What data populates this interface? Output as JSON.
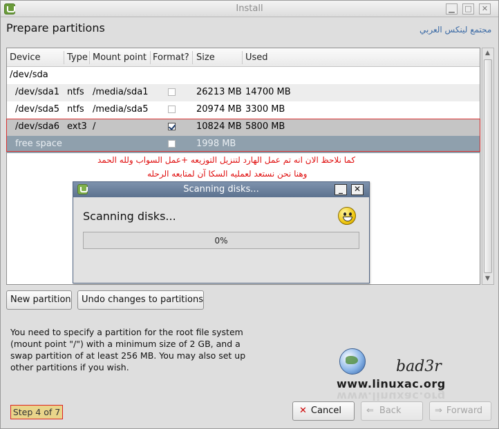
{
  "window": {
    "title": "Install"
  },
  "page": {
    "title": "Prepare partitions",
    "community_logo": "مجتمع لينكس العربي"
  },
  "table": {
    "columns": [
      "Device",
      "Type",
      "Mount point",
      "Format?",
      "Size",
      "Used"
    ],
    "disk": "/dev/sda",
    "rows": [
      {
        "device": "/dev/sda1",
        "type": "ntfs",
        "mount": "/media/sda1",
        "format": false,
        "size": "26213 MB",
        "used": "14700 MB"
      },
      {
        "device": "/dev/sda5",
        "type": "ntfs",
        "mount": "/media/sda5",
        "format": false,
        "size": "20974 MB",
        "used": "3300 MB"
      },
      {
        "device": "/dev/sda6",
        "type": "ext3",
        "mount": "/",
        "format": true,
        "size": "10824 MB",
        "used": "5800 MB"
      },
      {
        "device": "free space",
        "type": "",
        "mount": "",
        "format": false,
        "size": "1998 MB",
        "used": ""
      }
    ]
  },
  "annotation": {
    "line1": "كما نلاحظ الان انه تم عمل الهارد لتنزيل التوزيعه +عمل السواب ولله الحمد",
    "line2": "وهنا نحن نستعد لعمليه السكا آن لمتابعه الرحله"
  },
  "dialog": {
    "title": "Scanning disks...",
    "heading": "Scanning disks...",
    "progress_value": 0,
    "progress_label": "0%",
    "minimize_glyph": "_",
    "close_glyph": "✕"
  },
  "buttons": {
    "new_partition": "New partition",
    "undo": "Undo changes to partitions",
    "cancel": "Cancel",
    "back": "Back",
    "forward": "Forward"
  },
  "info_text": "You need to specify a partition for the root file system (mount point \"/\") with a minimum size of 2 GB, and a swap partition of at least 256 MB. You may also set up other partitions if you wish.",
  "step": "Step 4 of 7",
  "watermark": {
    "signature": "bad3r",
    "url": "www.linuxac.org"
  },
  "icons": [
    "install-app-icon",
    "minimize-icon",
    "maximize-icon",
    "close-icon",
    "checkbox-icon",
    "smiley-icon",
    "globe-icon",
    "cancel-x-icon",
    "back-arrow-icon",
    "forward-arrow-icon"
  ],
  "colors": {
    "selection": "#c5c5c5",
    "free_space": "#8fa0ad",
    "highlight_border": "#d93030",
    "dialog_titlebar": "#6a809d",
    "step_badge": "#e9d58a"
  }
}
